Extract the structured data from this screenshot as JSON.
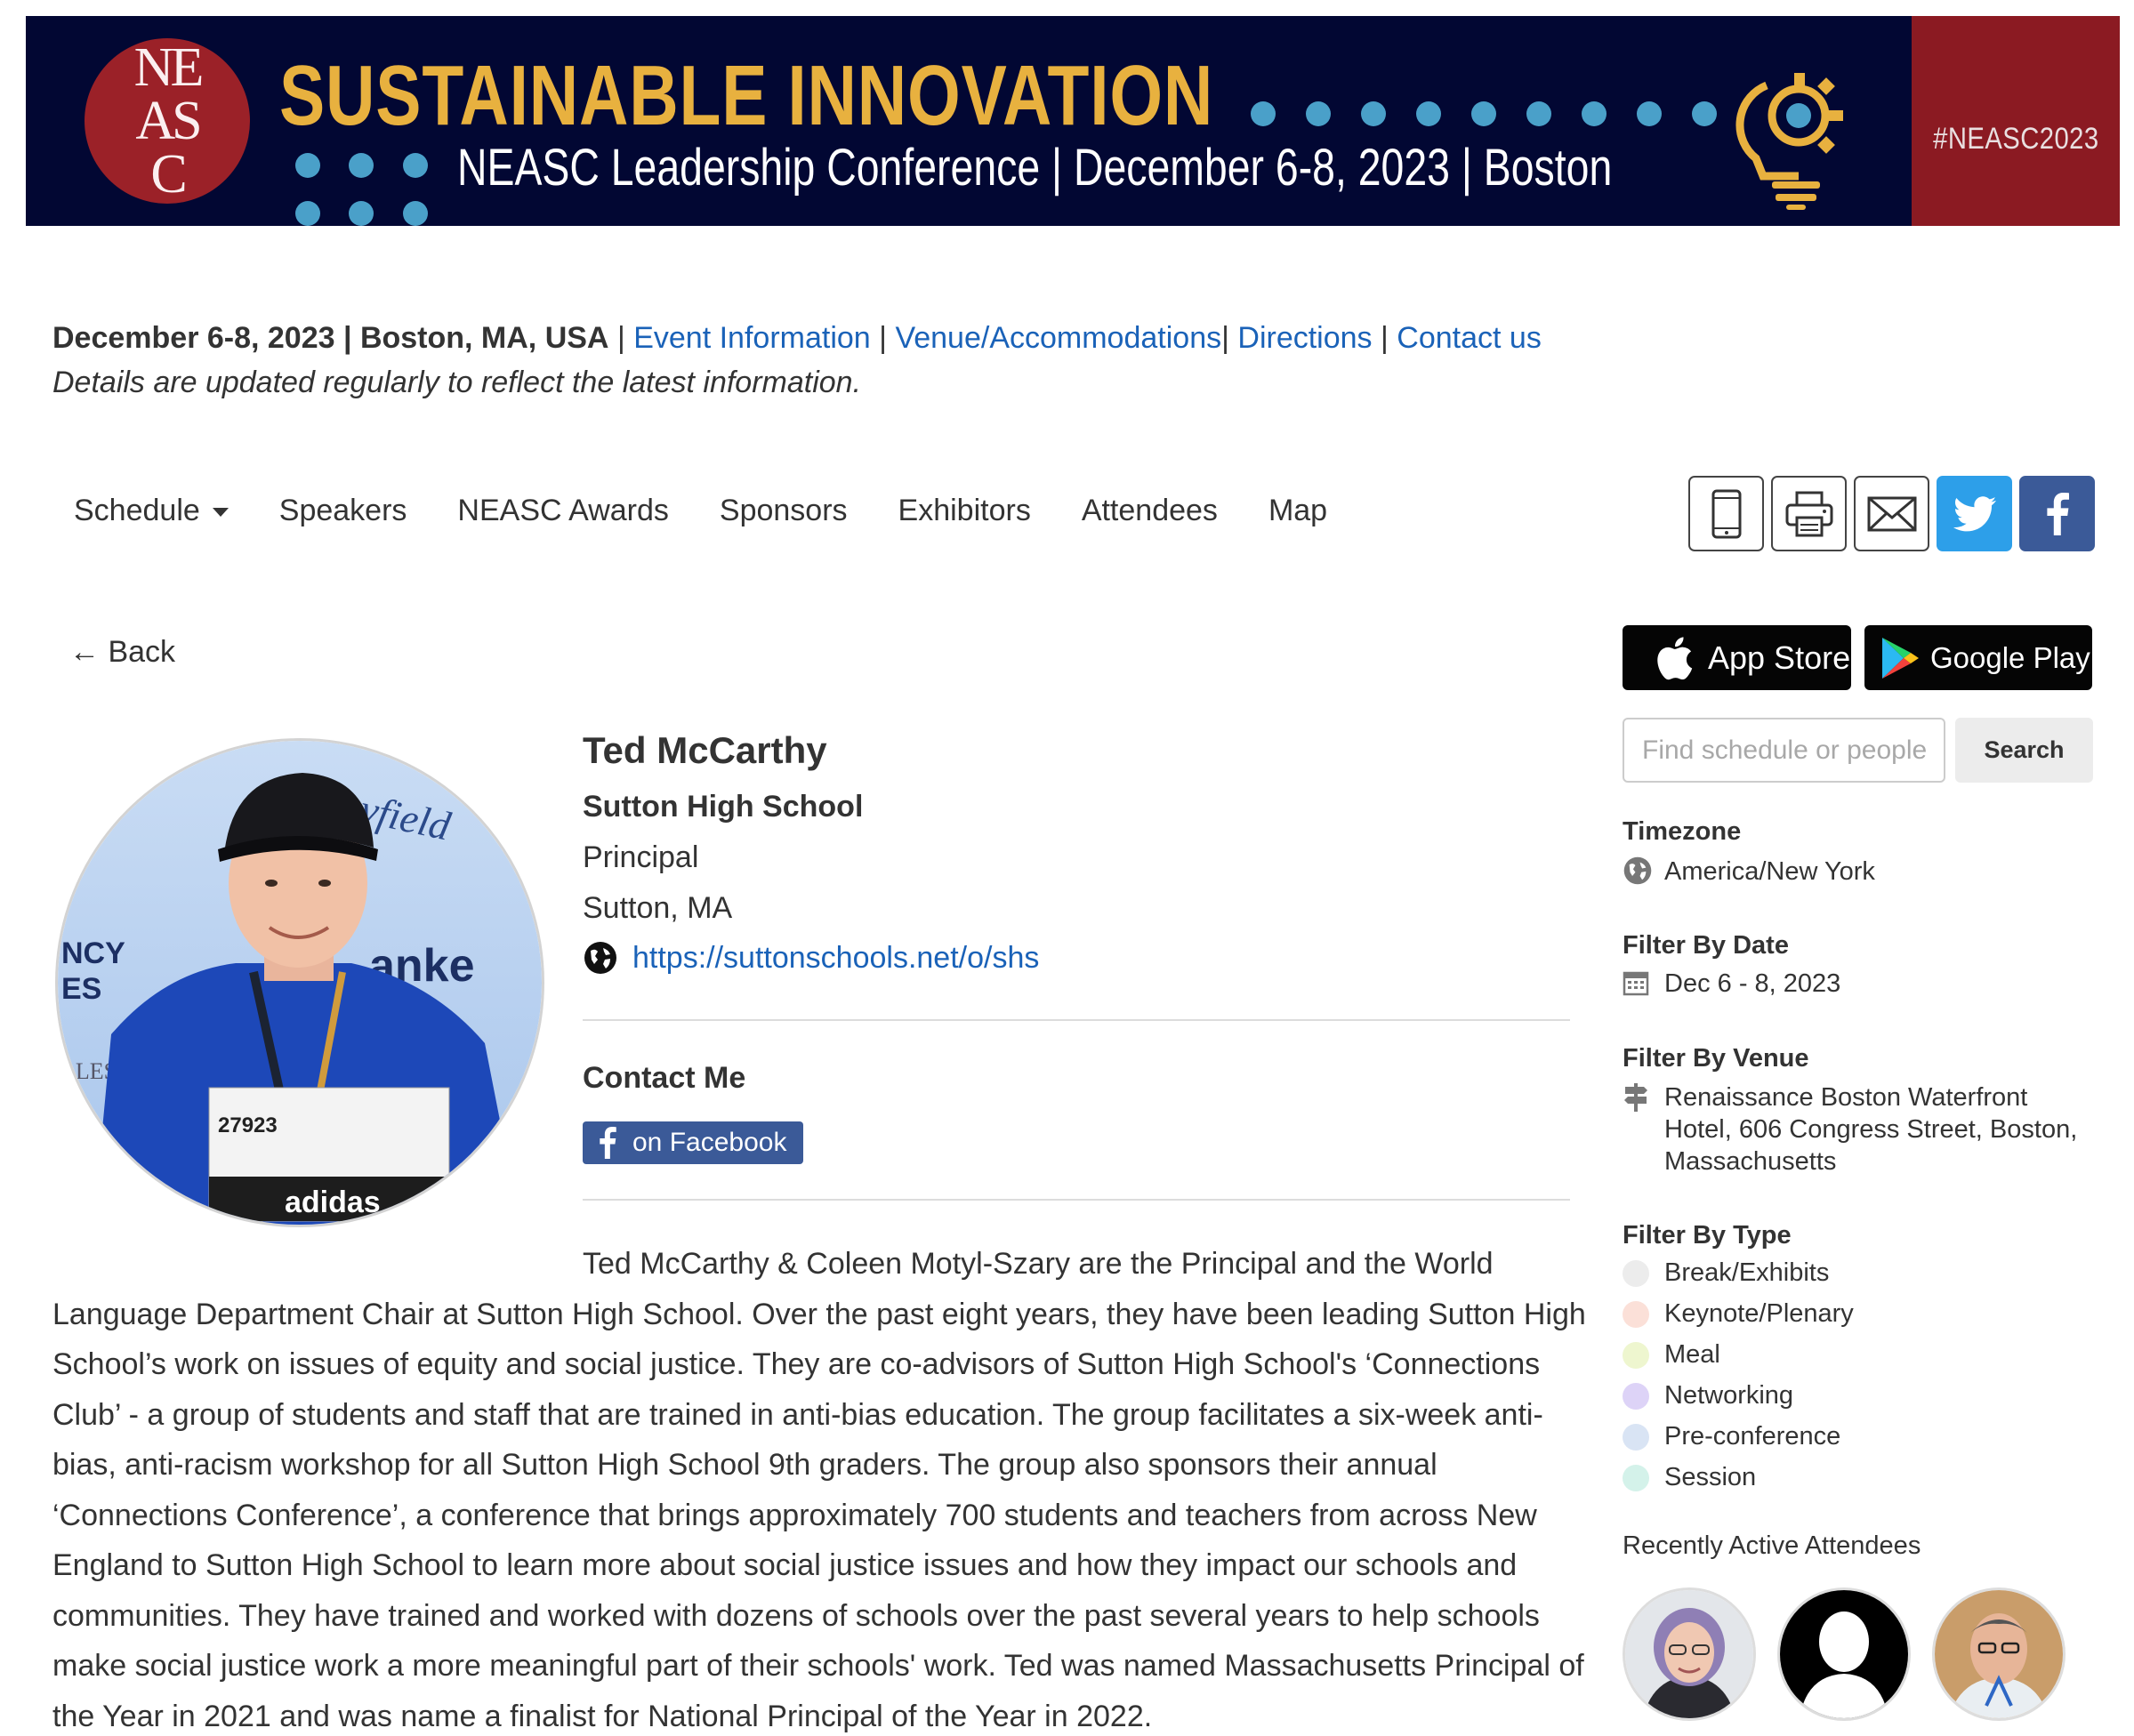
{
  "banner": {
    "logo_line1": "NE",
    "logo_line2": "AS",
    "logo_line3": "C",
    "title": "SUSTAINABLE  INNOVATION",
    "subtitle": "NEASC Leadership Conference  |  December 6-8, 2023  |  Boston",
    "hashtag": "#NEASC2023"
  },
  "info": {
    "date_location": "December 6-8, 2023 | Boston, MA, USA",
    "links": [
      "Event Information",
      "Venue/Accommodations",
      "Directions",
      "Contact us"
    ],
    "note": "Details are updated regularly to reflect the latest information."
  },
  "nav": {
    "items": [
      "Schedule",
      "Speakers",
      "NEASC Awards",
      "Sponsors",
      "Exhibitors",
      "Attendees",
      "Map"
    ]
  },
  "share": {
    "icons": [
      "mobile-icon",
      "print-icon",
      "email-icon",
      "twitter-icon",
      "facebook-icon"
    ]
  },
  "back_label": "← Back",
  "profile": {
    "name": "Ted McCarthy",
    "organization": "Sutton High School",
    "title": "Principal",
    "location": "Sutton, MA",
    "website": "https://suttonschools.net/o/shs",
    "contact_heading": "Contact Me",
    "facebook_label": "on Facebook",
    "bio": "Ted McCarthy & Coleen Motyl-Szary are the Principal and the World Language Department Chair at Sutton High School. Over the past eight years, they have been leading Sutton High School’s work on issues of equity and social justice. They are co-advisors of Sutton High School's ‘Connections Club’ - a group of students and staff that are trained in anti-bias education. The group facilitates a six-week anti-bias, anti-racism workshop for all Sutton High School 9th graders. The group also sponsors their annual ‘Connections Conference’, a conference that brings approximately 700 students and teachers from across New England to Sutton High School to learn more about social justice issues and how they impact our schools and communities. They have trained and worked with dozens of schools over the past several years to help schools make social justice work a more meaningful part of their schools' work. Ted was named Massachusetts Principal of the Year in 2021 and was name a finalist for National Principal of the Year in 2022."
  },
  "photo_text": {
    "bib_number": "27923",
    "sponsor": "adidas",
    "backdrop_1": "yfield",
    "backdrop_2": "anke",
    "backdrop_3": "NCY",
    "backdrop_4": "ES",
    "backdrop_5": "LLES"
  },
  "sidebar": {
    "app_store": "App Store",
    "google_play": "Google Play",
    "search_placeholder": "Find schedule or people",
    "search_button": "Search",
    "timezone_heading": "Timezone",
    "timezone_value": "America/New York",
    "date_heading": "Filter By Date",
    "date_value": "Dec 6 - 8, 2023",
    "venue_heading": "Filter By Venue",
    "venue_line1": "Renaissance Boston Waterfront",
    "venue_line2": "Hotel, 606 Congress Street, Boston,",
    "venue_line3": "Massachusetts",
    "type_heading": "Filter By Type",
    "types": [
      {
        "label": "Break/Exhibits",
        "color": "#ececec"
      },
      {
        "label": "Keynote/Plenary",
        "color": "#fbe0d8"
      },
      {
        "label": "Meal",
        "color": "#eef6cf"
      },
      {
        "label": "Networking",
        "color": "#ddd3f7"
      },
      {
        "label": "Pre-conference",
        "color": "#d9e4f4"
      },
      {
        "label": "Session",
        "color": "#d4f2ea"
      }
    ],
    "recent_heading": "Recently Active Attendees"
  },
  "colors": {
    "banner_navy": "#020733",
    "banner_red": "#8b1a22",
    "banner_gold": "#e8b13f",
    "link_blue": "#1a62b8",
    "facebook": "#3b5a98",
    "twitter": "#2d9fe9"
  }
}
